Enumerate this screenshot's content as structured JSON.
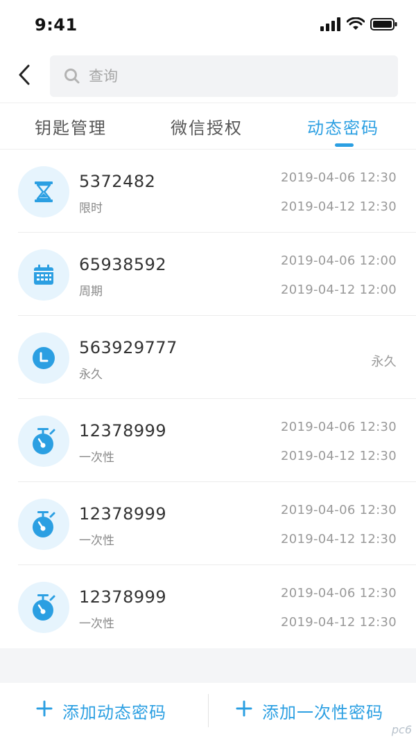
{
  "status_bar": {
    "time": "9:41"
  },
  "header": {
    "search_placeholder": "查询"
  },
  "tabs": [
    {
      "label": "钥匙管理",
      "active": false
    },
    {
      "label": "微信授权",
      "active": false
    },
    {
      "label": "动态密码",
      "active": true
    }
  ],
  "passwords": [
    {
      "icon": "hourglass-icon",
      "code": "5372482",
      "type": "限时",
      "start": "2019-04-06 12:30",
      "end": "2019-04-12 12:30"
    },
    {
      "icon": "calendar-icon",
      "code": "65938592",
      "type": "周期",
      "start": "2019-04-06 12:00",
      "end": "2019-04-12 12:00"
    },
    {
      "icon": "clock-icon",
      "code": "563929777",
      "type": "永久",
      "permanent": "永久"
    },
    {
      "icon": "stopwatch-icon",
      "code": "12378999",
      "type": "一次性",
      "start": "2019-04-06 12:30",
      "end": "2019-04-12 12:30"
    },
    {
      "icon": "stopwatch-icon",
      "code": "12378999",
      "type": "一次性",
      "start": "2019-04-06 12:30",
      "end": "2019-04-12 12:30"
    },
    {
      "icon": "stopwatch-icon",
      "code": "12378999",
      "type": "一次性",
      "start": "2019-04-06 12:30",
      "end": "2019-04-12 12:30"
    }
  ],
  "bottom_bar": {
    "add_dynamic": "添加动态密码",
    "add_one_time": "添加一次性密码"
  },
  "watermark": "pc6",
  "colors": {
    "accent": "#2b9fe2",
    "icon_bg": "#e6f4fd"
  }
}
